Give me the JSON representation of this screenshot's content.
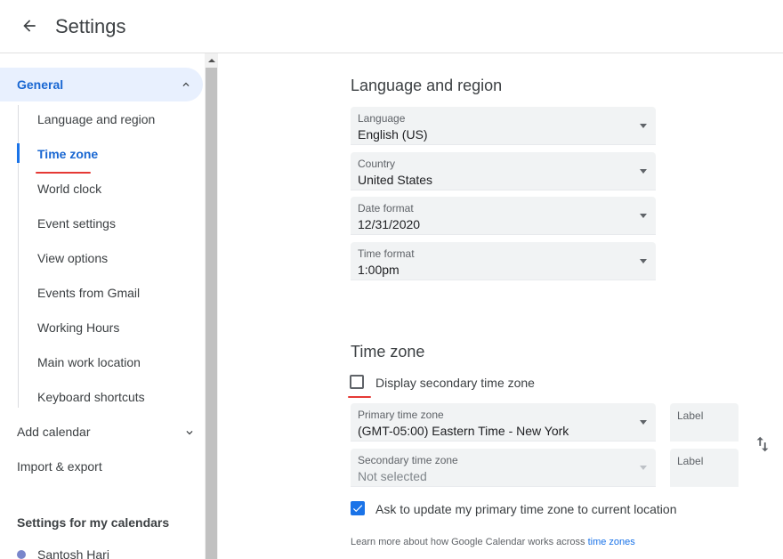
{
  "header": {
    "title": "Settings",
    "back_icon": "arrow-back-icon"
  },
  "sidebar": {
    "general": {
      "label": "General",
      "expanded": true
    },
    "sub_items": [
      {
        "label": "Language and region",
        "active": false
      },
      {
        "label": "Time zone",
        "active": true
      },
      {
        "label": "World clock",
        "active": false
      },
      {
        "label": "Event settings",
        "active": false
      },
      {
        "label": "View options",
        "active": false
      },
      {
        "label": "Events from Gmail",
        "active": false
      },
      {
        "label": "Working Hours",
        "active": false
      },
      {
        "label": "Main work location",
        "active": false
      },
      {
        "label": "Keyboard shortcuts",
        "active": false
      }
    ],
    "add_calendar": "Add calendar",
    "import_export": "Import & export",
    "my_calendars_heading": "Settings for my calendars",
    "calendars": [
      {
        "name": "Santosh Hari",
        "color": "#7986cb"
      }
    ]
  },
  "language_region": {
    "title": "Language and region",
    "fields": [
      {
        "label": "Language",
        "value": "English (US)"
      },
      {
        "label": "Country",
        "value": "United States"
      },
      {
        "label": "Date format",
        "value": "12/31/2020"
      },
      {
        "label": "Time format",
        "value": "1:00pm"
      }
    ]
  },
  "time_zone": {
    "title": "Time zone",
    "display_secondary_label": "Display secondary time zone",
    "display_secondary_checked": false,
    "primary": {
      "label": "Primary time zone",
      "value": "(GMT-05:00) Eastern Time - New York",
      "label_placeholder": "Label"
    },
    "secondary": {
      "label": "Secondary time zone",
      "value": "Not selected",
      "label_placeholder": "Label"
    },
    "ask_update_label": "Ask to update my primary time zone to current location",
    "ask_update_checked": true,
    "learn_more_text": "Learn more about how Google Calendar works across",
    "learn_more_link": "time zones"
  },
  "colors": {
    "accent": "#1a73e8",
    "active_bg": "#e8f0fe",
    "annotation_red": "#e53935"
  }
}
